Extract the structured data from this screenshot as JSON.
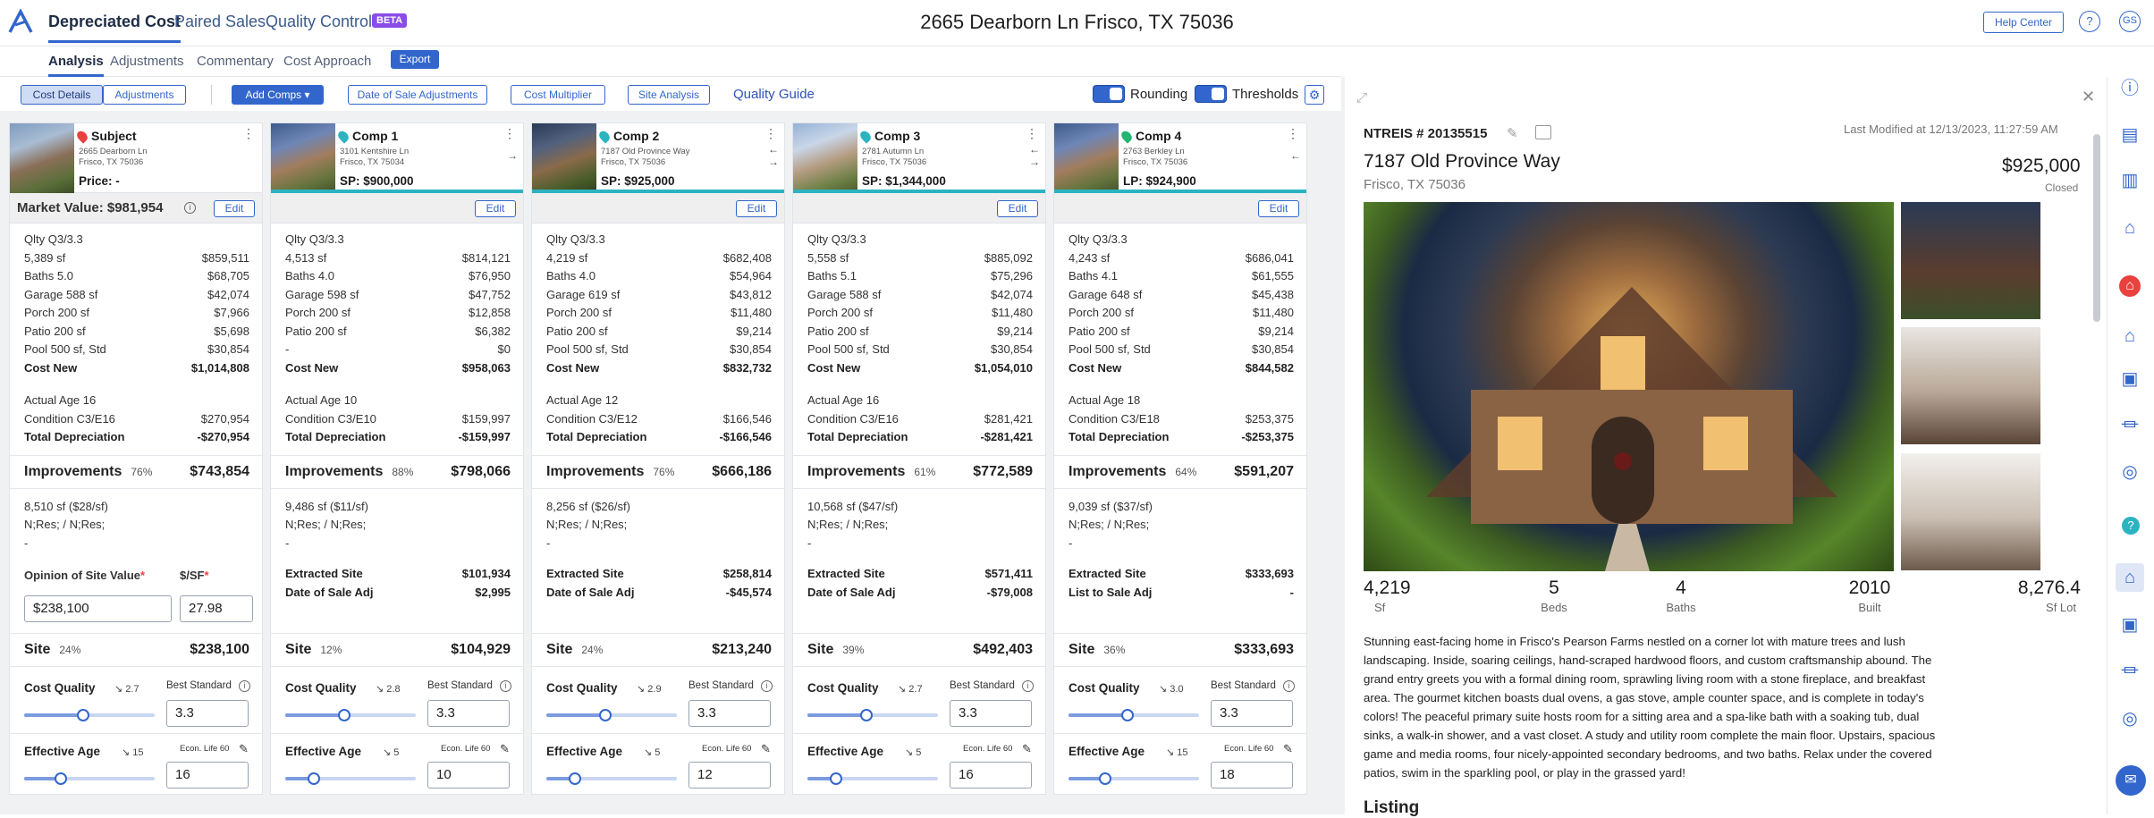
{
  "header": {
    "tabs": [
      "Depreciated Cost",
      "Paired Sales",
      "Quality Control"
    ],
    "beta": "BETA",
    "address": "2665 Dearborn Ln Frisco, TX 75036",
    "help": "Help Center",
    "help_icon": "?",
    "user": "GS"
  },
  "subtabs": [
    "Analysis",
    "Adjustments",
    "Commentary",
    "Cost Approach"
  ],
  "export": "Export",
  "toolbar": {
    "seg": [
      "Cost Details",
      "Adjustments"
    ],
    "add_comps": "Add Comps",
    "date_adj": "Date of Sale Adjustments",
    "cost_mult": "Cost Multiplier",
    "site_analysis": "Site Analysis",
    "quality_guide": "Quality Guide",
    "rounding": "Rounding",
    "thresholds": "Thresholds"
  },
  "cards": [
    {
      "title": "Subject",
      "pin_color": "#e8413e",
      "addr1": "2665 Dearborn Ln",
      "addr2": "Frisco, TX 75036",
      "price": "Price: -",
      "market_value": "Market Value: $981,954",
      "rows1": [
        [
          "Qlty Q3/3.3",
          ""
        ],
        [
          "5,389 sf",
          "$859,511"
        ],
        [
          "Baths 5.0",
          "$68,705"
        ],
        [
          "Garage 588 sf",
          "$42,074"
        ],
        [
          "Porch 200 sf",
          "$7,966"
        ],
        [
          "Patio 200 sf",
          "$5,698"
        ],
        [
          "Pool 500 sf, Std",
          "$30,854"
        ]
      ],
      "cost_new": "$1,014,808",
      "rows2": [
        [
          "Actual Age 16",
          ""
        ],
        [
          "Condition C3/E16",
          "$270,954"
        ]
      ],
      "total_dep": "-$270,954",
      "improvements": "$743,854",
      "imp_pct": "76%",
      "lot": "8,510 sf ($28/sf)",
      "nres": "N;Res; / N;Res;",
      "dash": "-",
      "site_label": "Opinion of Site Value",
      "site_label2": "$/SF",
      "site_input": "$238,100",
      "sf_input": "27.98",
      "site_value": "$238,100",
      "site_pct": "24%",
      "cq_val": "2.7",
      "best": "3.3",
      "cq_frac": 0.45,
      "eff_val": "15",
      "econ": "Econ. Life 60",
      "eff_input": "16",
      "eff_frac": 0.28
    },
    {
      "title": "Comp 1",
      "pin_color": "#2bb3c0",
      "addr1": "3101 Kentshire Ln",
      "addr2": "Frisco, TX 75034",
      "price": "SP: $900,000",
      "market_value": "",
      "rows1": [
        [
          "Qlty Q3/3.3",
          ""
        ],
        [
          "4,513 sf",
          "$814,121"
        ],
        [
          "Baths 4.0",
          "$76,950"
        ],
        [
          "Garage 598 sf",
          "$47,752"
        ],
        [
          "Porch 200 sf",
          "$12,858"
        ],
        [
          "Patio 200 sf",
          "$6,382"
        ],
        [
          "-",
          "$0"
        ]
      ],
      "cost_new": "$958,063",
      "rows2": [
        [
          "Actual Age 10",
          ""
        ],
        [
          "Condition C3/E10",
          "$159,997"
        ]
      ],
      "total_dep": "-$159,997",
      "improvements": "$798,066",
      "imp_pct": "88%",
      "lot": "9,486 sf ($11/sf)",
      "nres": "N;Res; / N;Res;",
      "dash": "-",
      "ex_site": "$101,934",
      "adj_label": "Date of Sale Adj",
      "adj": "$2,995",
      "site_value": "$104,929",
      "site_pct": "12%",
      "cq_val": "2.8",
      "best": "3.3",
      "cq_frac": 0.45,
      "eff_val": "5",
      "econ": "Econ. Life 60",
      "eff_input": "10",
      "eff_frac": 0.22
    },
    {
      "title": "Comp 2",
      "pin_color": "#2bb3c0",
      "addr1": "7187 Old Province Way",
      "addr2": "Frisco, TX 75036",
      "price": "SP: $925,000",
      "market_value": "",
      "rows1": [
        [
          "Qlty Q3/3.3",
          ""
        ],
        [
          "4,219 sf",
          "$682,408"
        ],
        [
          "Baths 4.0",
          "$54,964"
        ],
        [
          "Garage 619 sf",
          "$43,812"
        ],
        [
          "Porch 200 sf",
          "$11,480"
        ],
        [
          "Patio 200 sf",
          "$9,214"
        ],
        [
          "Pool 500 sf, Std",
          "$30,854"
        ]
      ],
      "cost_new": "$832,732",
      "rows2": [
        [
          "Actual Age 12",
          ""
        ],
        [
          "Condition C3/E12",
          "$166,546"
        ]
      ],
      "total_dep": "-$166,546",
      "improvements": "$666,186",
      "imp_pct": "76%",
      "lot": "8,256 sf ($26/sf)",
      "nres": "N;Res; / N;Res;",
      "dash": "-",
      "ex_site": "$258,814",
      "adj_label": "Date of Sale Adj",
      "adj": "-$45,574",
      "site_value": "$213,240",
      "site_pct": "24%",
      "cq_val": "2.9",
      "best": "3.3",
      "cq_frac": 0.45,
      "eff_val": "5",
      "econ": "Econ. Life 60",
      "eff_input": "12",
      "eff_frac": 0.22
    },
    {
      "title": "Comp 3",
      "pin_color": "#2bb3c0",
      "addr1": "2781 Autumn Ln",
      "addr2": "Frisco, TX 75036",
      "price": "SP: $1,344,000",
      "market_value": "",
      "rows1": [
        [
          "Qlty Q3/3.3",
          ""
        ],
        [
          "5,558 sf",
          "$885,092"
        ],
        [
          "Baths 5.1",
          "$75,296"
        ],
        [
          "Garage 588 sf",
          "$42,074"
        ],
        [
          "Porch 200 sf",
          "$11,480"
        ],
        [
          "Patio 200 sf",
          "$9,214"
        ],
        [
          "Pool 500 sf, Std",
          "$30,854"
        ]
      ],
      "cost_new": "$1,054,010",
      "rows2": [
        [
          "Actual Age 16",
          ""
        ],
        [
          "Condition C3/E16",
          "$281,421"
        ]
      ],
      "total_dep": "-$281,421",
      "improvements": "$772,589",
      "imp_pct": "61%",
      "lot": "10,568 sf ($47/sf)",
      "nres": "N;Res; / N;Res;",
      "dash": "-",
      "ex_site": "$571,411",
      "adj_label": "Date of Sale Adj",
      "adj": "-$79,008",
      "site_value": "$492,403",
      "site_pct": "39%",
      "cq_val": "2.7",
      "best": "3.3",
      "cq_frac": 0.45,
      "eff_val": "5",
      "econ": "Econ. Life 60",
      "eff_input": "16",
      "eff_frac": 0.22
    },
    {
      "title": "Comp 4",
      "pin_color": "#22b573",
      "addr1": "2763 Berkley Ln",
      "addr2": "Frisco, TX 75036",
      "price": "LP: $924,900",
      "market_value": "",
      "rows1": [
        [
          "Qlty Q3/3.3",
          ""
        ],
        [
          "4,243 sf",
          "$686,041"
        ],
        [
          "Baths 4.1",
          "$61,555"
        ],
        [
          "Garage 648 sf",
          "$45,438"
        ],
        [
          "Porch 200 sf",
          "$11,480"
        ],
        [
          "Patio 200 sf",
          "$9,214"
        ],
        [
          "Pool 500 sf, Std",
          "$30,854"
        ]
      ],
      "cost_new": "$844,582",
      "rows2": [
        [
          "Actual Age 18",
          ""
        ],
        [
          "Condition C3/E18",
          "$253,375"
        ]
      ],
      "total_dep": "-$253,375",
      "improvements": "$591,207",
      "imp_pct": "64%",
      "lot": "9,039 sf ($37/sf)",
      "nres": "N;Res; / N;Res;",
      "dash": "-",
      "ex_site": "$333,693",
      "adj_label": "List to Sale Adj",
      "adj": "-",
      "site_value": "$333,693",
      "site_pct": "36%",
      "cq_val": "3.0",
      "best": "3.3",
      "cq_frac": 0.45,
      "eff_val": "15",
      "econ": "Econ. Life 60",
      "eff_input": "18",
      "eff_frac": 0.28
    }
  ],
  "labels": {
    "edit": "Edit",
    "cost_new": "Cost New",
    "total_dep": "Total Depreciation",
    "improvements": "Improvements",
    "extracted_site": "Extracted Site",
    "site": "Site",
    "cost_quality": "Cost Quality",
    "best_standard": "Best Standard",
    "effective_age": "Effective Age"
  },
  "detail": {
    "mls": "NTREIS # 20135515",
    "modified": "Last Modified at 12/13/2023, 11:27:59 AM",
    "street": "7187 Old Province Way",
    "city": "Frisco, TX 75036",
    "price": "$925,000",
    "status": "Closed",
    "stats": [
      [
        "4,219",
        "Sf"
      ],
      [
        "5",
        "Beds"
      ],
      [
        "4",
        "Baths"
      ],
      [
        "2010",
        "Built"
      ],
      [
        "8,276.4",
        "Sf Lot"
      ]
    ],
    "description": "Stunning east-facing home in Frisco's Pearson Farms nestled on a corner lot with mature trees and lush landscaping. Inside, soaring ceilings, hand-scraped hardwood floors, and custom craftsmanship abound. The grand entry greets you with a formal dining room, sprawling living room with a stone fireplace, and breakfast area. The gourmet kitchen boasts dual ovens, a gas stove, ample counter space, and is complete in today's colors! The peaceful primary suite hosts room for a sitting area and a spa-like bath with a soaking tub, dual sinks, a walk-in shower, and a vast closet. A study and utility room complete the main floor. Upstairs, spacious game and media rooms, four nicely-appointed secondary bedrooms, and two baths. Relax under the covered patios, swim in the sparkling pool, or play in the grassed yard!",
    "listing_heading": "Listing"
  },
  "side_icons": [
    "info-icon",
    "map-icon",
    "chart-icon",
    "house-alert-icon",
    "home-icon",
    "home-value-icon",
    "image-icon",
    "bank-icon",
    "coins-icon",
    "help-icon",
    "house-check-icon",
    "gallery-icon",
    "museum-icon",
    "dollar-coins-icon",
    "chat-icon"
  ],
  "colors": {
    "accent": "#3266cc",
    "teal": "#2bb3c0",
    "red": "#e8413e",
    "green": "#22b573",
    "beta": "#8a4de8"
  }
}
